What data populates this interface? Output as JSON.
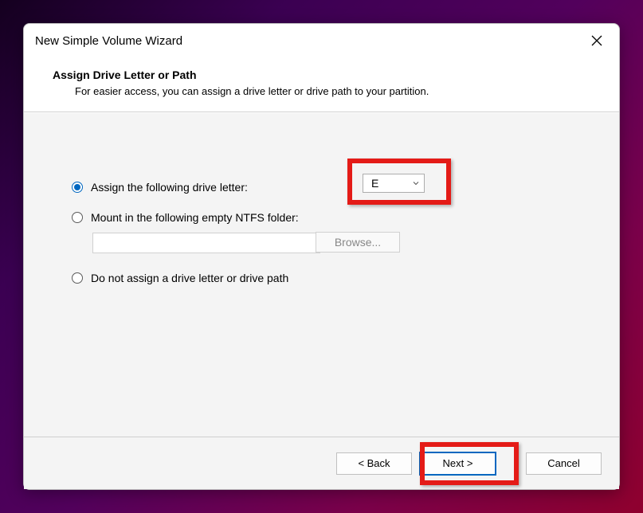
{
  "window": {
    "title": "New Simple Volume Wizard"
  },
  "header": {
    "title": "Assign Drive Letter or Path",
    "subtitle": "For easier access, you can assign a drive letter or drive path to your partition."
  },
  "options": {
    "assign_letter": {
      "label": "Assign the following drive letter:",
      "selected": true,
      "value": "E"
    },
    "mount_folder": {
      "label": "Mount in the following empty NTFS folder:",
      "selected": false,
      "path": "",
      "browse_label": "Browse..."
    },
    "no_assign": {
      "label": "Do not assign a drive letter or drive path",
      "selected": false
    }
  },
  "footer": {
    "back": "< Back",
    "next": "Next >",
    "cancel": "Cancel"
  }
}
